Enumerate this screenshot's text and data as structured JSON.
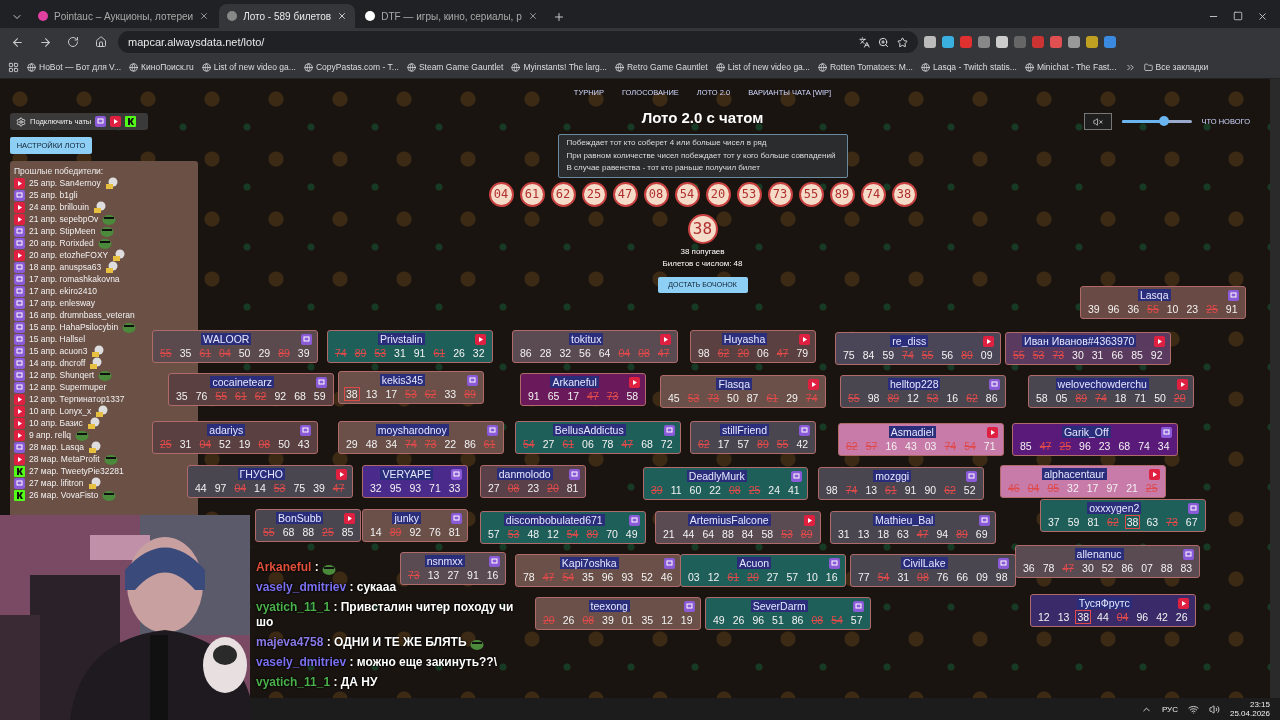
{
  "browser": {
    "tabs": [
      {
        "title": "Pointauc – Аукционы, лотереи",
        "selected": false
      },
      {
        "title": "Лото - 589 билетов",
        "selected": true
      },
      {
        "title": "DTF — игры, кино, сериалы, р",
        "selected": false
      }
    ],
    "url": "mapcar.alwaysdata.net/loto/",
    "bookmarks": [
      "HoBot — Бот для V...",
      "КиноПоиск.ru",
      "List of new video ga...",
      "CopyPastas.com - T...",
      "Steam Game Gauntlet",
      "Myinstants! The larg...",
      "Retro Game Gauntlet",
      "List of new video ga...",
      "Rotten Tomatoes: M...",
      "Lasqa - Twitch statis...",
      "Minichat - The Fast..."
    ],
    "all_bookmarks": "Все закладки"
  },
  "nav": [
    "ТУРНИР",
    "ГОЛОСОВАНИЕ",
    "ЛОТО 2.0",
    "ВАРИАНТЫ ЧАТА [WIP]"
  ],
  "connect_chats": "Подключить чаты",
  "settings_button": "НАСТРОЙКИ ЛОТО",
  "audio": {
    "muted": true,
    "level": 0.6
  },
  "whats_new": "ЧТО НОВОГО",
  "title": "Лото 2.0 с чатом",
  "rules": [
    "Побеждает тот кто соберет 4 или больше чисел в ряд",
    "При равном количестве чисел побеждает тот у кого больше совпадений",
    "В случае равенства - тот кто раньше получил билет"
  ],
  "drawn": [
    "04",
    "61",
    "62",
    "25",
    "47",
    "08",
    "54",
    "20",
    "53",
    "73",
    "55",
    "89",
    "74",
    "38"
  ],
  "current": "38",
  "current_caption": "38 попугаев",
  "tickets_with_number": "Билетов с числом: 48",
  "draw_button": "ДОСТАТЬ БОЧОНОК",
  "winners": {
    "title": "Прошлые победители:",
    "items": [
      {
        "text": "25 апр. San4ernoy",
        "kind": "youtube"
      },
      {
        "text": "25 апр. b1gli",
        "kind": "twitch"
      },
      {
        "text": "24 апр. brillouin",
        "kind": "youtube"
      },
      {
        "text": "21 апр. sepebpOv",
        "kind": "youtube"
      },
      {
        "text": "21 апр. StipMeen",
        "kind": "twitch"
      },
      {
        "text": "20 апр. Rorixded",
        "kind": "twitch"
      },
      {
        "text": "20 апр. etozheFOXY",
        "kind": "youtube"
      },
      {
        "text": "18 апр. anuspsa63",
        "kind": "twitch"
      },
      {
        "text": "17 апр. romashkakovna",
        "kind": "twitch"
      },
      {
        "text": "17 апр. ekiro2410",
        "kind": "twitch"
      },
      {
        "text": "17 апр. enlesway",
        "kind": "twitch"
      },
      {
        "text": "16 апр. drumnbass_veteran",
        "kind": "twitch"
      },
      {
        "text": "15 апр. HahaPsilocybin",
        "kind": "twitch"
      },
      {
        "text": "15 апр. Hallsel",
        "kind": "twitch"
      },
      {
        "text": "15 апр. acuon3",
        "kind": "twitch"
      },
      {
        "text": "14 апр. dncroff",
        "kind": "twitch"
      },
      {
        "text": "12 апр. Shunqert",
        "kind": "twitch"
      },
      {
        "text": "12 апр. Supermuper",
        "kind": "twitch"
      },
      {
        "text": "12 апр. Терпинатор1337",
        "kind": "youtube"
      },
      {
        "text": "10 апр. Lonyx_x",
        "kind": "youtube"
      },
      {
        "text": "10 апр. Базис",
        "kind": "youtube"
      },
      {
        "text": "9 апр. rellq",
        "kind": "youtube"
      },
      {
        "text": "28 мар. Lasqa",
        "kind": "twitch"
      },
      {
        "text": "28 мар. MetaProfit",
        "kind": "youtube"
      },
      {
        "text": "27 мар. TweetyPie32281",
        "kind": "kick"
      },
      {
        "text": "27 мар. lifitron",
        "kind": "twitch"
      },
      {
        "text": "26 мар. VovaFisto",
        "kind": "kick"
      }
    ]
  },
  "tickets": [
    {
      "name": "Lasqa",
      "kind": "twitch",
      "color": "#6a4a44",
      "numbers": [
        {
          "value": "39",
          "kind": "plain"
        },
        {
          "value": "96",
          "kind": "plain"
        },
        {
          "value": "36",
          "kind": "plain"
        },
        {
          "value": "55",
          "kind": "hit"
        },
        {
          "value": "10",
          "kind": "plain"
        },
        {
          "value": "23",
          "kind": "plain"
        },
        {
          "value": "25",
          "kind": "hit"
        },
        {
          "value": "91",
          "kind": "plain"
        }
      ]
    },
    {
      "name": "WALOOR",
      "kind": "twitch",
      "color": "#5a4a4e",
      "numbers": [
        {
          "value": "55",
          "kind": "hit"
        },
        {
          "value": "35",
          "kind": "plain"
        },
        {
          "value": "61",
          "kind": "hit"
        },
        {
          "value": "04",
          "kind": "hit"
        },
        {
          "value": "50",
          "kind": "plain"
        },
        {
          "value": "29",
          "kind": "plain"
        },
        {
          "value": "89",
          "kind": "hit"
        },
        {
          "value": "39",
          "kind": "plain"
        }
      ]
    },
    {
      "name": "Privstalin",
      "kind": "youtube",
      "color": "#1f5f5a",
      "numbers": [
        {
          "value": "74",
          "kind": "hit"
        },
        {
          "value": "89",
          "kind": "hit"
        },
        {
          "value": "53",
          "kind": "hit"
        },
        {
          "value": "31",
          "kind": "plain"
        },
        {
          "value": "91",
          "kind": "plain"
        },
        {
          "value": "61",
          "kind": "hit"
        },
        {
          "value": "26",
          "kind": "plain"
        },
        {
          "value": "32",
          "kind": "plain"
        }
      ]
    },
    {
      "name": "tokitux",
      "kind": "youtube",
      "color": "#5a4a52",
      "numbers": [
        {
          "value": "86",
          "kind": "plain"
        },
        {
          "value": "28",
          "kind": "plain"
        },
        {
          "value": "32",
          "kind": "plain"
        },
        {
          "value": "56",
          "kind": "plain"
        },
        {
          "value": "64",
          "kind": "plain"
        },
        {
          "value": "04",
          "kind": "hit"
        },
        {
          "value": "08",
          "kind": "hit"
        },
        {
          "value": "47",
          "kind": "hit"
        }
      ]
    },
    {
      "name": "Huyasha",
      "kind": "youtube",
      "color": "#5a4040",
      "numbers": [
        {
          "value": "98",
          "kind": "plain"
        },
        {
          "value": "62",
          "kind": "hit"
        },
        {
          "value": "20",
          "kind": "hit"
        },
        {
          "value": "06",
          "kind": "plain"
        },
        {
          "value": "47",
          "kind": "hit"
        },
        {
          "value": "79",
          "kind": "plain"
        }
      ]
    },
    {
      "name": "re_diss",
      "kind": "youtube",
      "color": "#4a4658",
      "numbers": [
        {
          "value": "75",
          "kind": "plain"
        },
        {
          "value": "84",
          "kind": "plain"
        },
        {
          "value": "59",
          "kind": "plain"
        },
        {
          "value": "74",
          "kind": "hit"
        },
        {
          "value": "55",
          "kind": "hit"
        },
        {
          "value": "56",
          "kind": "plain"
        },
        {
          "value": "89",
          "kind": "hit"
        },
        {
          "value": "09",
          "kind": "plain"
        }
      ]
    },
    {
      "name": "Иван Иванов#4363970",
      "kind": "youtube",
      "color": "#5a3a5e",
      "numbers": [
        {
          "value": "55",
          "kind": "hit"
        },
        {
          "value": "53",
          "kind": "hit"
        },
        {
          "value": "73",
          "kind": "hit"
        },
        {
          "value": "30",
          "kind": "plain"
        },
        {
          "value": "31",
          "kind": "plain"
        },
        {
          "value": "66",
          "kind": "plain"
        },
        {
          "value": "85",
          "kind": "plain"
        },
        {
          "value": "92",
          "kind": "plain"
        }
      ]
    },
    {
      "name": "cocainetearz",
      "kind": "twitch",
      "color": "#5a4040",
      "numbers": [
        {
          "value": "35",
          "kind": "plain"
        },
        {
          "value": "76",
          "kind": "plain"
        },
        {
          "value": "55",
          "kind": "hit"
        },
        {
          "value": "61",
          "kind": "hit"
        },
        {
          "value": "62",
          "kind": "hit"
        },
        {
          "value": "92",
          "kind": "plain"
        },
        {
          "value": "68",
          "kind": "plain"
        },
        {
          "value": "59",
          "kind": "plain"
        }
      ]
    },
    {
      "name": "kekis345",
      "kind": "twitch",
      "color": "#6a5048",
      "numbers": [
        {
          "value": "38",
          "kind": "current"
        },
        {
          "value": "13",
          "kind": "plain"
        },
        {
          "value": "17",
          "kind": "plain"
        },
        {
          "value": "53",
          "kind": "hit"
        },
        {
          "value": "62",
          "kind": "hit"
        },
        {
          "value": "33",
          "kind": "plain"
        },
        {
          "value": "89",
          "kind": "hit"
        }
      ]
    },
    {
      "name": "Arkaneful",
      "kind": "youtube",
      "color": "#6a1a5a",
      "numbers": [
        {
          "value": "91",
          "kind": "plain"
        },
        {
          "value": "65",
          "kind": "plain"
        },
        {
          "value": "17",
          "kind": "plain"
        },
        {
          "value": "47",
          "kind": "hit"
        },
        {
          "value": "73",
          "kind": "hit"
        },
        {
          "value": "58",
          "kind": "plain"
        }
      ]
    },
    {
      "name": "Flasqa",
      "kind": "youtube",
      "color": "#6a5048",
      "numbers": [
        {
          "value": "45",
          "kind": "plain"
        },
        {
          "value": "53",
          "kind": "hit"
        },
        {
          "value": "73",
          "kind": "hit"
        },
        {
          "value": "50",
          "kind": "plain"
        },
        {
          "value": "87",
          "kind": "plain"
        },
        {
          "value": "61",
          "kind": "hit"
        },
        {
          "value": "29",
          "kind": "plain"
        },
        {
          "value": "74",
          "kind": "hit"
        }
      ]
    },
    {
      "name": "helltop228",
      "kind": "twitch",
      "color": "#4a4650",
      "numbers": [
        {
          "value": "55",
          "kind": "hit"
        },
        {
          "value": "98",
          "kind": "plain"
        },
        {
          "value": "89",
          "kind": "hit"
        },
        {
          "value": "12",
          "kind": "plain"
        },
        {
          "value": "53",
          "kind": "hit"
        },
        {
          "value": "16",
          "kind": "plain"
        },
        {
          "value": "62",
          "kind": "hit"
        },
        {
          "value": "86",
          "kind": "plain"
        }
      ]
    },
    {
      "name": "welovechowderchu",
      "kind": "youtube",
      "color": "#4a4650",
      "numbers": [
        {
          "value": "58",
          "kind": "plain"
        },
        {
          "value": "05",
          "kind": "plain"
        },
        {
          "value": "89",
          "kind": "hit"
        },
        {
          "value": "74",
          "kind": "hit"
        },
        {
          "value": "18",
          "kind": "plain"
        },
        {
          "value": "71",
          "kind": "plain"
        },
        {
          "value": "50",
          "kind": "plain"
        },
        {
          "value": "20",
          "kind": "hit"
        }
      ]
    },
    {
      "name": "adariys",
      "kind": "twitch",
      "color": "#5a4040",
      "numbers": [
        {
          "value": "25",
          "kind": "hit"
        },
        {
          "value": "31",
          "kind": "plain"
        },
        {
          "value": "04",
          "kind": "hit"
        },
        {
          "value": "52",
          "kind": "plain"
        },
        {
          "value": "19",
          "kind": "plain"
        },
        {
          "value": "08",
          "kind": "hit"
        },
        {
          "value": "50",
          "kind": "plain"
        },
        {
          "value": "43",
          "kind": "plain"
        }
      ]
    },
    {
      "name": "moysharodnoy",
      "kind": "twitch",
      "color": "#6a5048",
      "numbers": [
        {
          "value": "29",
          "kind": "plain"
        },
        {
          "value": "48",
          "kind": "plain"
        },
        {
          "value": "34",
          "kind": "plain"
        },
        {
          "value": "74",
          "kind": "hit"
        },
        {
          "value": "73",
          "kind": "hit"
        },
        {
          "value": "22",
          "kind": "plain"
        },
        {
          "value": "86",
          "kind": "plain"
        },
        {
          "value": "61",
          "kind": "hit"
        }
      ]
    },
    {
      "name": "BellusAddictus",
      "kind": "twitch",
      "color": "#1f5f5a",
      "numbers": [
        {
          "value": "54",
          "kind": "hit"
        },
        {
          "value": "27",
          "kind": "plain"
        },
        {
          "value": "61",
          "kind": "hit"
        },
        {
          "value": "06",
          "kind": "plain"
        },
        {
          "value": "78",
          "kind": "plain"
        },
        {
          "value": "47",
          "kind": "hit"
        },
        {
          "value": "68",
          "kind": "plain"
        },
        {
          "value": "72",
          "kind": "plain"
        }
      ]
    },
    {
      "name": "stillFriend",
      "kind": "twitch",
      "color": "#4a4650",
      "numbers": [
        {
          "value": "62",
          "kind": "hit"
        },
        {
          "value": "17",
          "kind": "plain"
        },
        {
          "value": "57",
          "kind": "plain"
        },
        {
          "value": "89",
          "kind": "hit"
        },
        {
          "value": "55",
          "kind": "hit"
        },
        {
          "value": "42",
          "kind": "plain"
        }
      ]
    },
    {
      "name": "Asmadiel",
      "kind": "youtube",
      "color": "#c87aa8",
      "numbers": [
        {
          "value": "62",
          "kind": "hit"
        },
        {
          "value": "57",
          "kind": "hit"
        },
        {
          "value": "16",
          "kind": "plain"
        },
        {
          "value": "43",
          "kind": "plain"
        },
        {
          "value": "03",
          "kind": "plain"
        },
        {
          "value": "74",
          "kind": "hit"
        },
        {
          "value": "54",
          "kind": "hit"
        },
        {
          "value": "71",
          "kind": "plain"
        }
      ]
    },
    {
      "name": "Garik_Off",
      "kind": "twitch",
      "color": "#5a1a7a",
      "numbers": [
        {
          "value": "85",
          "kind": "plain"
        },
        {
          "value": "47",
          "kind": "hit"
        },
        {
          "value": "25",
          "kind": "hit"
        },
        {
          "value": "96",
          "kind": "plain"
        },
        {
          "value": "23",
          "kind": "plain"
        },
        {
          "value": "68",
          "kind": "plain"
        },
        {
          "value": "74",
          "kind": "plain"
        },
        {
          "value": "34",
          "kind": "plain"
        }
      ]
    },
    {
      "name": "ГНУСНО",
      "kind": "youtube",
      "color": "#4a4650",
      "numbers": [
        {
          "value": "44",
          "kind": "plain"
        },
        {
          "value": "97",
          "kind": "plain"
        },
        {
          "value": "04",
          "kind": "hit"
        },
        {
          "value": "14",
          "kind": "plain"
        },
        {
          "value": "53",
          "kind": "hit"
        },
        {
          "value": "75",
          "kind": "plain"
        },
        {
          "value": "39",
          "kind": "plain"
        },
        {
          "value": "47",
          "kind": "hit"
        }
      ]
    },
    {
      "name": "VERYAPE",
      "kind": "twitch",
      "color": "#4a2a8a",
      "numbers": [
        {
          "value": "32",
          "kind": "plain"
        },
        {
          "value": "95",
          "kind": "plain"
        },
        {
          "value": "93",
          "kind": "plain"
        },
        {
          "value": "71",
          "kind": "plain"
        },
        {
          "value": "33",
          "kind": "plain"
        }
      ]
    },
    {
      "name": "danmolodo",
      "kind": "twitch",
      "color": "#5a4048",
      "numbers": [
        {
          "value": "27",
          "kind": "plain"
        },
        {
          "value": "08",
          "kind": "hit"
        },
        {
          "value": "23",
          "kind": "plain"
        },
        {
          "value": "20",
          "kind": "hit"
        },
        {
          "value": "81",
          "kind": "plain"
        }
      ]
    },
    {
      "name": "DeadlyMurk",
      "kind": "twitch",
      "color": "#1f5f5a",
      "numbers": [
        {
          "value": "39",
          "kind": "hit"
        },
        {
          "value": "11",
          "kind": "plain"
        },
        {
          "value": "60",
          "kind": "plain"
        },
        {
          "value": "22",
          "kind": "plain"
        },
        {
          "value": "08",
          "kind": "hit"
        },
        {
          "value": "25",
          "kind": "hit"
        },
        {
          "value": "24",
          "kind": "plain"
        },
        {
          "value": "41",
          "kind": "plain"
        }
      ]
    },
    {
      "name": "mozggi",
      "kind": "twitch",
      "color": "#4a4650",
      "numbers": [
        {
          "value": "98",
          "kind": "plain"
        },
        {
          "value": "74",
          "kind": "hit"
        },
        {
          "value": "13",
          "kind": "plain"
        },
        {
          "value": "61",
          "kind": "hit"
        },
        {
          "value": "91",
          "kind": "plain"
        },
        {
          "value": "90",
          "kind": "plain"
        },
        {
          "value": "62",
          "kind": "hit"
        },
        {
          "value": "52",
          "kind": "plain"
        }
      ]
    },
    {
      "name": "alphacentaur",
      "kind": "youtube",
      "color": "#c87aa8",
      "numbers": [
        {
          "value": "46",
          "kind": "hit"
        },
        {
          "value": "04",
          "kind": "hit"
        },
        {
          "value": "95",
          "kind": "hit"
        },
        {
          "value": "32",
          "kind": "plain"
        },
        {
          "value": "17",
          "kind": "plain"
        },
        {
          "value": "97",
          "kind": "plain"
        },
        {
          "value": "21",
          "kind": "plain"
        },
        {
          "value": "25",
          "kind": "hit"
        }
      ]
    },
    {
      "name": "oxxxygen2",
      "kind": "twitch",
      "color": "#1f5f5a",
      "numbers": [
        {
          "value": "37",
          "kind": "plain"
        },
        {
          "value": "59",
          "kind": "plain"
        },
        {
          "value": "81",
          "kind": "plain"
        },
        {
          "value": "62",
          "kind": "hit"
        },
        {
          "value": "38",
          "kind": "current"
        },
        {
          "value": "63",
          "kind": "plain"
        },
        {
          "value": "73",
          "kind": "hit"
        },
        {
          "value": "67",
          "kind": "plain"
        }
      ]
    },
    {
      "name": "BonSubb",
      "kind": "youtube",
      "color": "#4a4650",
      "numbers": [
        {
          "value": "55",
          "kind": "hit"
        },
        {
          "value": "68",
          "kind": "plain"
        },
        {
          "value": "88",
          "kind": "plain"
        },
        {
          "value": "25",
          "kind": "hit"
        },
        {
          "value": "85",
          "kind": "plain"
        }
      ]
    },
    {
      "name": "junky",
      "kind": "twitch",
      "color": "#6a5048",
      "numbers": [
        {
          "value": "14",
          "kind": "plain"
        },
        {
          "value": "89",
          "kind": "hit"
        },
        {
          "value": "92",
          "kind": "plain"
        },
        {
          "value": "76",
          "kind": "plain"
        },
        {
          "value": "81",
          "kind": "plain"
        }
      ]
    },
    {
      "name": "discombobulated671",
      "kind": "twitch",
      "color": "#1f5f5a",
      "numbers": [
        {
          "value": "57",
          "kind": "plain"
        },
        {
          "value": "53",
          "kind": "hit"
        },
        {
          "value": "48",
          "kind": "plain"
        },
        {
          "value": "12",
          "kind": "plain"
        },
        {
          "value": "54",
          "kind": "hit"
        },
        {
          "value": "89",
          "kind": "hit"
        },
        {
          "value": "70",
          "kind": "plain"
        },
        {
          "value": "49",
          "kind": "plain"
        }
      ]
    },
    {
      "name": "ArtemiusFalcone",
      "kind": "youtube",
      "color": "#5a4a52",
      "numbers": [
        {
          "value": "21",
          "kind": "plain"
        },
        {
          "value": "44",
          "kind": "plain"
        },
        {
          "value": "64",
          "kind": "plain"
        },
        {
          "value": "88",
          "kind": "plain"
        },
        {
          "value": "84",
          "kind": "plain"
        },
        {
          "value": "58",
          "kind": "plain"
        },
        {
          "value": "53",
          "kind": "hit"
        },
        {
          "value": "89",
          "kind": "hit"
        }
      ]
    },
    {
      "name": "Mathieu_Bal",
      "kind": "twitch",
      "color": "#4a4650",
      "numbers": [
        {
          "value": "31",
          "kind": "plain"
        },
        {
          "value": "13",
          "kind": "plain"
        },
        {
          "value": "18",
          "kind": "plain"
        },
        {
          "value": "63",
          "kind": "plain"
        },
        {
          "value": "47",
          "kind": "hit"
        },
        {
          "value": "94",
          "kind": "plain"
        },
        {
          "value": "89",
          "kind": "hit"
        },
        {
          "value": "69",
          "kind": "plain"
        }
      ]
    },
    {
      "name": "nsnmxx",
      "kind": "twitch",
      "color": "#5a4a52",
      "numbers": [
        {
          "value": "73",
          "kind": "hit"
        },
        {
          "value": "13",
          "kind": "plain"
        },
        {
          "value": "27",
          "kind": "plain"
        },
        {
          "value": "91",
          "kind": "plain"
        },
        {
          "value": "16",
          "kind": "plain"
        }
      ]
    },
    {
      "name": "Kapi7oshka",
      "kind": "twitch",
      "color": "#6a5048",
      "numbers": [
        {
          "value": "78",
          "kind": "plain"
        },
        {
          "value": "47",
          "kind": "hit"
        },
        {
          "value": "54",
          "kind": "hit"
        },
        {
          "value": "35",
          "kind": "plain"
        },
        {
          "value": "96",
          "kind": "plain"
        },
        {
          "value": "93",
          "kind": "plain"
        },
        {
          "value": "52",
          "kind": "plain"
        },
        {
          "value": "46",
          "kind": "plain"
        }
      ]
    },
    {
      "name": "Acuon",
      "kind": "twitch",
      "color": "#1f5f5a",
      "numbers": [
        {
          "value": "03",
          "kind": "plain"
        },
        {
          "value": "12",
          "kind": "plain"
        },
        {
          "value": "61",
          "kind": "hit"
        },
        {
          "value": "20",
          "kind": "hit"
        },
        {
          "value": "27",
          "kind": "plain"
        },
        {
          "value": "57",
          "kind": "plain"
        },
        {
          "value": "10",
          "kind": "plain"
        },
        {
          "value": "16",
          "kind": "plain"
        }
      ]
    },
    {
      "name": "CivilLake",
      "kind": "twitch",
      "color": "#4a4650",
      "numbers": [
        {
          "value": "77",
          "kind": "plain"
        },
        {
          "value": "54",
          "kind": "hit"
        },
        {
          "value": "31",
          "kind": "plain"
        },
        {
          "value": "08",
          "kind": "hit"
        },
        {
          "value": "76",
          "kind": "plain"
        },
        {
          "value": "66",
          "kind": "plain"
        },
        {
          "value": "09",
          "kind": "plain"
        },
        {
          "value": "98",
          "kind": "plain"
        }
      ]
    },
    {
      "name": "allenanuc",
      "kind": "twitch",
      "color": "#5a4a52",
      "numbers": [
        {
          "value": "36",
          "kind": "plain"
        },
        {
          "value": "78",
          "kind": "plain"
        },
        {
          "value": "47",
          "kind": "hit"
        },
        {
          "value": "30",
          "kind": "plain"
        },
        {
          "value": "52",
          "kind": "plain"
        },
        {
          "value": "86",
          "kind": "plain"
        },
        {
          "value": "07",
          "kind": "plain"
        },
        {
          "value": "88",
          "kind": "plain"
        },
        {
          "value": "83",
          "kind": "plain"
        }
      ]
    },
    {
      "name": "teexong",
      "kind": "twitch",
      "color": "#6a5048",
      "numbers": [
        {
          "value": "20",
          "kind": "hit"
        },
        {
          "value": "26",
          "kind": "plain"
        },
        {
          "value": "08",
          "kind": "hit"
        },
        {
          "value": "39",
          "kind": "plain"
        },
        {
          "value": "01",
          "kind": "plain"
        },
        {
          "value": "35",
          "kind": "plain"
        },
        {
          "value": "12",
          "kind": "plain"
        },
        {
          "value": "19",
          "kind": "plain"
        }
      ]
    },
    {
      "name": "SeverDarm",
      "kind": "twitch",
      "color": "#1f5f5a",
      "numbers": [
        {
          "value": "49",
          "kind": "plain"
        },
        {
          "value": "26",
          "kind": "plain"
        },
        {
          "value": "96",
          "kind": "plain"
        },
        {
          "value": "51",
          "kind": "plain"
        },
        {
          "value": "86",
          "kind": "plain"
        },
        {
          "value": "08",
          "kind": "hit"
        },
        {
          "value": "54",
          "kind": "hit"
        },
        {
          "value": "57",
          "kind": "plain"
        }
      ]
    },
    {
      "name": "ТусяФрутс",
      "kind": "youtube",
      "color": "#3a2a6a",
      "numbers": [
        {
          "value": "12",
          "kind": "plain"
        },
        {
          "value": "13",
          "kind": "plain"
        },
        {
          "value": "38",
          "kind": "current"
        },
        {
          "value": "44",
          "kind": "plain"
        },
        {
          "value": "04",
          "kind": "hit"
        },
        {
          "value": "96",
          "kind": "plain"
        },
        {
          "value": "42",
          "kind": "plain"
        },
        {
          "value": "26",
          "kind": "plain"
        }
      ]
    }
  ],
  "chat": [
    {
      "user": "Arkaneful",
      "color": "#e0503a",
      "text": ":",
      "emote": true
    },
    {
      "user": "vasely_dmitriev",
      "color": "#7a70f0",
      "text": ": сукааа",
      "emote": false
    },
    {
      "user": "vyatich_11_1",
      "color": "#4ab04a",
      "text": ": Привсталин читер походу чи шо",
      "emote": false
    },
    {
      "user": "majeva4758",
      "color": "#8a7ae8",
      "text": ": ОДНИ И ТЕ ЖЕ БЛЯТЬ",
      "emote": true
    },
    {
      "user": "vasely_dmitriev",
      "color": "#7a70f0",
      "text": ": можно еще закинуть??\\",
      "emote": false
    },
    {
      "user": "vyatich_11_1",
      "color": "#4ab04a",
      "text": ": ДА НУ",
      "emote": false
    }
  ],
  "taskbar": {
    "language": "РУС",
    "time": "23:15",
    "date": "25.04.2026"
  }
}
